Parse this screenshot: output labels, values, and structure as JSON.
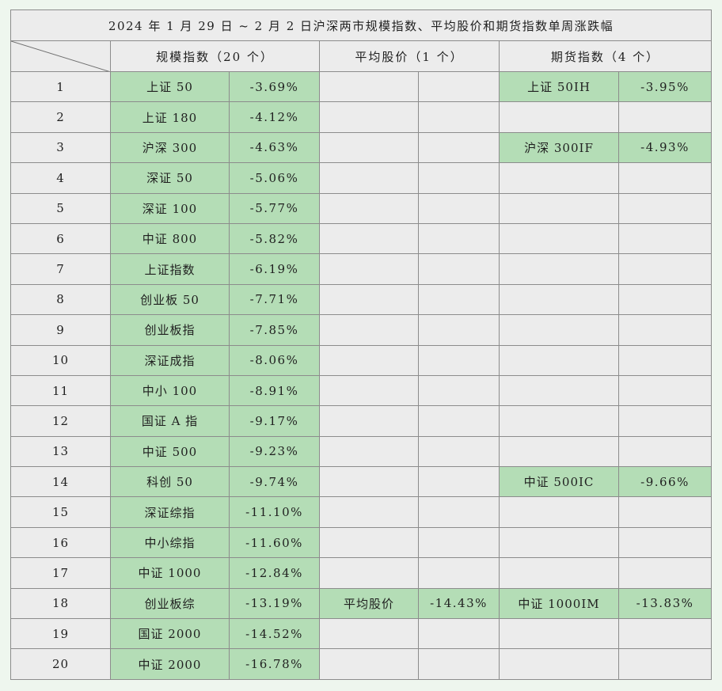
{
  "chart_data": {
    "type": "table",
    "title": "2024年1月29日～2月2日沪深两市规模指数、平均股价和期货指数单周涨跌幅",
    "title_display": "2024 年 1 月 29 日 ~ 2 月 2 日沪深两市规模指数、平均股价和期货指数单周涨跌幅",
    "column_groups": [
      "规模指数（20 个）",
      "平均股价（1 个）",
      "期货指数（4 个）"
    ],
    "highlight_color": "#b4ddb6",
    "rows": [
      {
        "rank": "1",
        "scale_name": "上证 50",
        "scale_change": "-3.69%",
        "avg_name": "",
        "avg_change": "",
        "fut_name": "上证 50IH",
        "fut_change": "-3.95%"
      },
      {
        "rank": "2",
        "scale_name": "上证 180",
        "scale_change": "-4.12%",
        "avg_name": "",
        "avg_change": "",
        "fut_name": "",
        "fut_change": ""
      },
      {
        "rank": "3",
        "scale_name": "沪深 300",
        "scale_change": "-4.63%",
        "avg_name": "",
        "avg_change": "",
        "fut_name": "沪深 300IF",
        "fut_change": "-4.93%"
      },
      {
        "rank": "4",
        "scale_name": "深证 50",
        "scale_change": "-5.06%",
        "avg_name": "",
        "avg_change": "",
        "fut_name": "",
        "fut_change": ""
      },
      {
        "rank": "5",
        "scale_name": "深证 100",
        "scale_change": "-5.77%",
        "avg_name": "",
        "avg_change": "",
        "fut_name": "",
        "fut_change": ""
      },
      {
        "rank": "6",
        "scale_name": "中证 800",
        "scale_change": "-5.82%",
        "avg_name": "",
        "avg_change": "",
        "fut_name": "",
        "fut_change": ""
      },
      {
        "rank": "7",
        "scale_name": "上证指数",
        "scale_change": "-6.19%",
        "avg_name": "",
        "avg_change": "",
        "fut_name": "",
        "fut_change": ""
      },
      {
        "rank": "8",
        "scale_name": "创业板 50",
        "scale_change": "-7.71%",
        "avg_name": "",
        "avg_change": "",
        "fut_name": "",
        "fut_change": ""
      },
      {
        "rank": "9",
        "scale_name": "创业板指",
        "scale_change": "-7.85%",
        "avg_name": "",
        "avg_change": "",
        "fut_name": "",
        "fut_change": ""
      },
      {
        "rank": "10",
        "scale_name": "深证成指",
        "scale_change": "-8.06%",
        "avg_name": "",
        "avg_change": "",
        "fut_name": "",
        "fut_change": ""
      },
      {
        "rank": "11",
        "scale_name": "中小 100",
        "scale_change": "-8.91%",
        "avg_name": "",
        "avg_change": "",
        "fut_name": "",
        "fut_change": ""
      },
      {
        "rank": "12",
        "scale_name": "国证 A 指",
        "scale_change": "-9.17%",
        "avg_name": "",
        "avg_change": "",
        "fut_name": "",
        "fut_change": ""
      },
      {
        "rank": "13",
        "scale_name": "中证 500",
        "scale_change": "-9.23%",
        "avg_name": "",
        "avg_change": "",
        "fut_name": "",
        "fut_change": ""
      },
      {
        "rank": "14",
        "scale_name": "科创 50",
        "scale_change": "-9.74%",
        "avg_name": "",
        "avg_change": "",
        "fut_name": "中证 500IC",
        "fut_change": "-9.66%"
      },
      {
        "rank": "15",
        "scale_name": "深证综指",
        "scale_change": "-11.10%",
        "avg_name": "",
        "avg_change": "",
        "fut_name": "",
        "fut_change": ""
      },
      {
        "rank": "16",
        "scale_name": "中小综指",
        "scale_change": "-11.60%",
        "avg_name": "",
        "avg_change": "",
        "fut_name": "",
        "fut_change": ""
      },
      {
        "rank": "17",
        "scale_name": "中证 1000",
        "scale_change": "-12.84%",
        "avg_name": "",
        "avg_change": "",
        "fut_name": "",
        "fut_change": ""
      },
      {
        "rank": "18",
        "scale_name": "创业板综",
        "scale_change": "-13.19%",
        "avg_name": "平均股价",
        "avg_change": "-14.43%",
        "fut_name": "中证 1000IM",
        "fut_change": "-13.83%"
      },
      {
        "rank": "19",
        "scale_name": "国证 2000",
        "scale_change": "-14.52%",
        "avg_name": "",
        "avg_change": "",
        "fut_name": "",
        "fut_change": ""
      },
      {
        "rank": "20",
        "scale_name": "中证 2000",
        "scale_change": "-16.78%",
        "avg_name": "",
        "avg_change": "",
        "fut_name": "",
        "fut_change": ""
      }
    ]
  }
}
